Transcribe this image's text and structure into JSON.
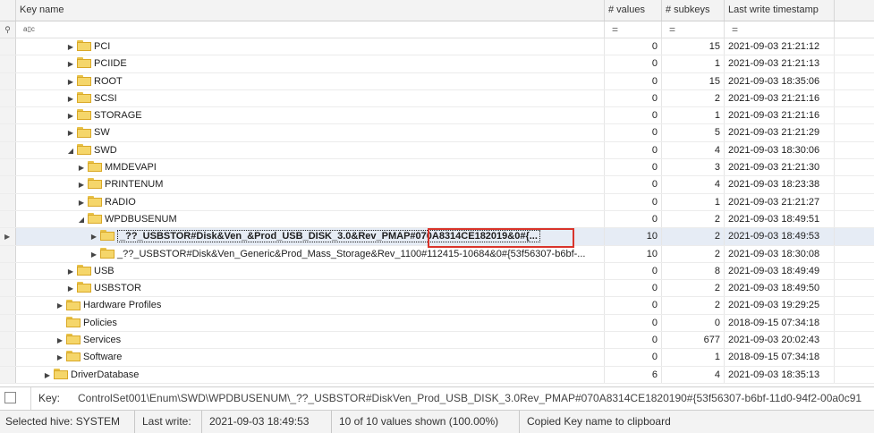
{
  "columns": {
    "key_name": "Key name",
    "values": "# values",
    "subkeys": "# subkeys",
    "timestamp": "Last write timestamp"
  },
  "filter": {
    "eq1": "=",
    "eq2": "=",
    "eq3": "=",
    "abc": "a▯c"
  },
  "rows": [
    {
      "name": "PCI",
      "level": 4,
      "expanded": false,
      "values": "0",
      "subkeys": "15",
      "ts": "2021-09-03 21:21:12"
    },
    {
      "name": "PCIIDE",
      "level": 4,
      "expanded": false,
      "values": "0",
      "subkeys": "1",
      "ts": "2021-09-03 21:21:13"
    },
    {
      "name": "ROOT",
      "level": 4,
      "expanded": false,
      "values": "0",
      "subkeys": "15",
      "ts": "2021-09-03 18:35:06"
    },
    {
      "name": "SCSI",
      "level": 4,
      "expanded": false,
      "values": "0",
      "subkeys": "2",
      "ts": "2021-09-03 21:21:16"
    },
    {
      "name": "STORAGE",
      "level": 4,
      "expanded": false,
      "values": "0",
      "subkeys": "1",
      "ts": "2021-09-03 21:21:16"
    },
    {
      "name": "SW",
      "level": 4,
      "expanded": false,
      "values": "0",
      "subkeys": "5",
      "ts": "2021-09-03 21:21:29"
    },
    {
      "name": "SWD",
      "level": 4,
      "expanded": true,
      "values": "0",
      "subkeys": "4",
      "ts": "2021-09-03 18:30:06"
    },
    {
      "name": "MMDEVAPI",
      "level": 5,
      "expanded": false,
      "values": "0",
      "subkeys": "3",
      "ts": "2021-09-03 21:21:30"
    },
    {
      "name": "PRINTENUM",
      "level": 5,
      "expanded": false,
      "values": "0",
      "subkeys": "4",
      "ts": "2021-09-03 18:23:38"
    },
    {
      "name": "RADIO",
      "level": 5,
      "expanded": false,
      "values": "0",
      "subkeys": "1",
      "ts": "2021-09-03 21:21:27"
    },
    {
      "name": "WPDBUSENUM",
      "level": 5,
      "expanded": true,
      "values": "0",
      "subkeys": "2",
      "ts": "2021-09-03 18:49:51"
    },
    {
      "name": "_??_USBSTOR#Disk&Ven_&Prod_USB_DISK_3.0&Rev_PMAP#070A8314CE182019&0#{...",
      "level": 6,
      "expanded": false,
      "selected": true,
      "values": "10",
      "subkeys": "2",
      "ts": "2021-09-03 18:49:53"
    },
    {
      "name": "_??_USBSTOR#Disk&Ven_Generic&Prod_Mass_Storage&Rev_1100#112415-10684&0#{53f56307-b6bf-...",
      "level": 6,
      "expanded": false,
      "values": "10",
      "subkeys": "2",
      "ts": "2021-09-03 18:30:08"
    },
    {
      "name": "USB",
      "level": 4,
      "expanded": false,
      "values": "0",
      "subkeys": "8",
      "ts": "2021-09-03 18:49:49"
    },
    {
      "name": "USBSTOR",
      "level": 4,
      "expanded": false,
      "values": "0",
      "subkeys": "2",
      "ts": "2021-09-03 18:49:50"
    },
    {
      "name": "Hardware Profiles",
      "level": 3,
      "expanded": false,
      "values": "0",
      "subkeys": "2",
      "ts": "2021-09-03 19:29:25"
    },
    {
      "name": "Policies",
      "level": 3,
      "expanded": null,
      "values": "0",
      "subkeys": "0",
      "ts": "2018-09-15 07:34:18"
    },
    {
      "name": "Services",
      "level": 3,
      "expanded": false,
      "values": "0",
      "subkeys": "677",
      "ts": "2021-09-03 20:02:43"
    },
    {
      "name": "Software",
      "level": 3,
      "expanded": false,
      "values": "0",
      "subkeys": "1",
      "ts": "2018-09-15 07:34:18"
    },
    {
      "name": "DriverDatabase",
      "level": 2,
      "expanded": false,
      "values": "6",
      "subkeys": "4",
      "ts": "2021-09-03 18:35:13"
    }
  ],
  "keybar": {
    "label": "Key:",
    "value": "ControlSet001\\Enum\\SWD\\WPDBUSENUM\\_??_USBSTOR#DiskVen_Prod_USB_DISK_3.0Rev_PMAP#070A8314CE1820190#{53f56307-b6bf-11d0-94f2-00a0c91"
  },
  "status": {
    "hive": "Selected hive: SYSTEM",
    "last_write_label": "Last write:",
    "last_write_value": "2021-09-03 18:49:53",
    "values_shown": "10 of 10 values shown (100.00%)",
    "message": "Copied Key name to clipboard"
  }
}
